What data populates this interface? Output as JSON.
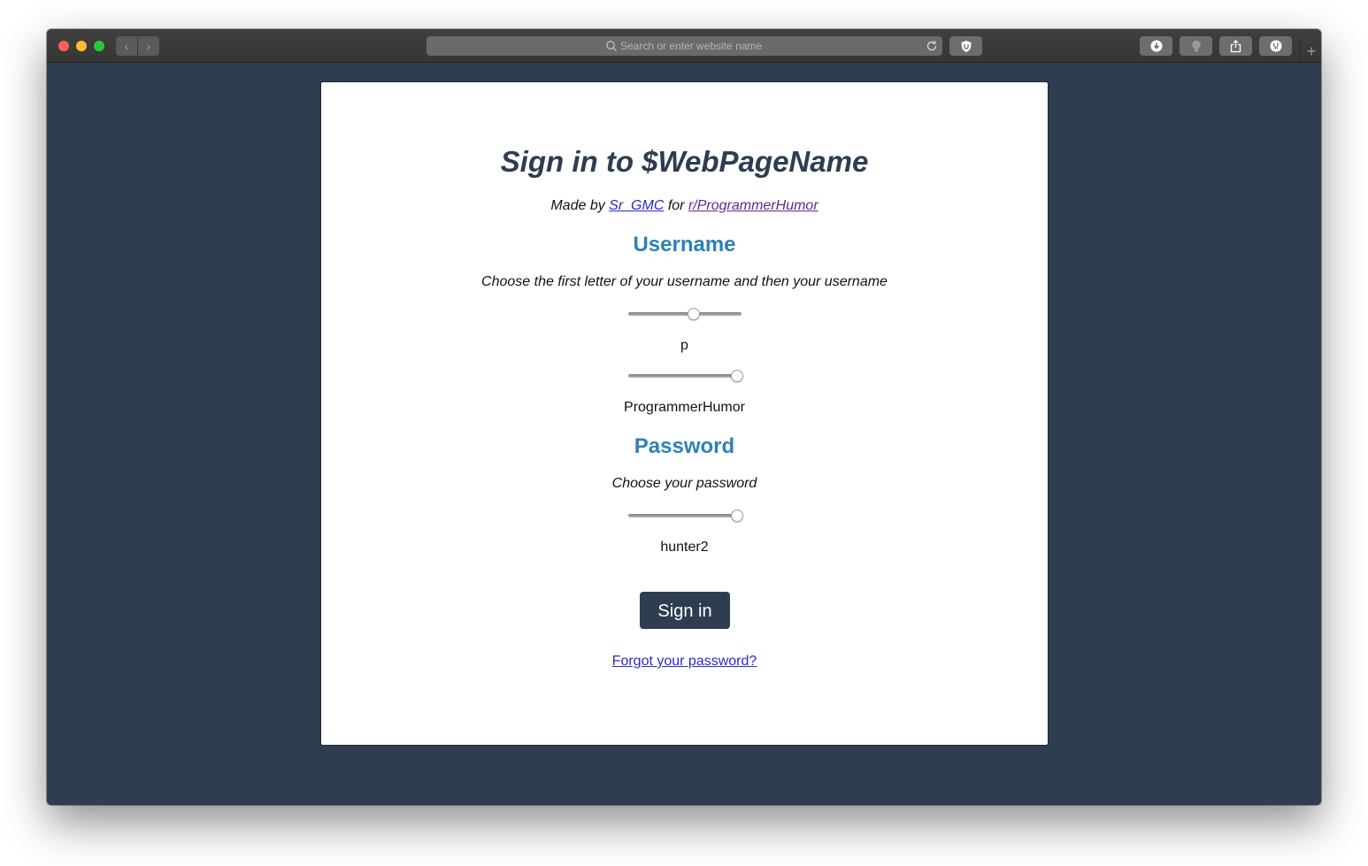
{
  "browser": {
    "address_placeholder": "Search or enter website name",
    "back_label": "‹",
    "forward_label": "›",
    "new_tab_label": "+"
  },
  "page": {
    "title": "Sign in to $WebPageName",
    "made_by_prefix": "Made by ",
    "author_link": "Sr_GMC",
    "made_by_middle": " for ",
    "subreddit_link": "r/ProgrammerHumor",
    "username": {
      "heading": "Username",
      "hint": "Choose the first letter of your username and then your username",
      "letter_slider_level": 0.57,
      "letter_value": "p",
      "name_slider_level": 0.95,
      "name_value": "ProgrammerHumor"
    },
    "password": {
      "heading": "Password",
      "hint": "Choose your password",
      "slider_level": 0.95,
      "value": "hunter2"
    },
    "signin_label": "Sign in",
    "forgot_link": "Forgot your password?"
  },
  "colors": {
    "background": "#2e3d50",
    "heading_accent": "#2f80b9",
    "button": "#2e3d50",
    "link": "#2a2acd",
    "visited_link": "#5d2a90"
  },
  "icons": [
    "search-icon",
    "reload-icon",
    "shield-icon",
    "download-icon",
    "lightbulb-icon",
    "share-icon",
    "extension-icon"
  ]
}
